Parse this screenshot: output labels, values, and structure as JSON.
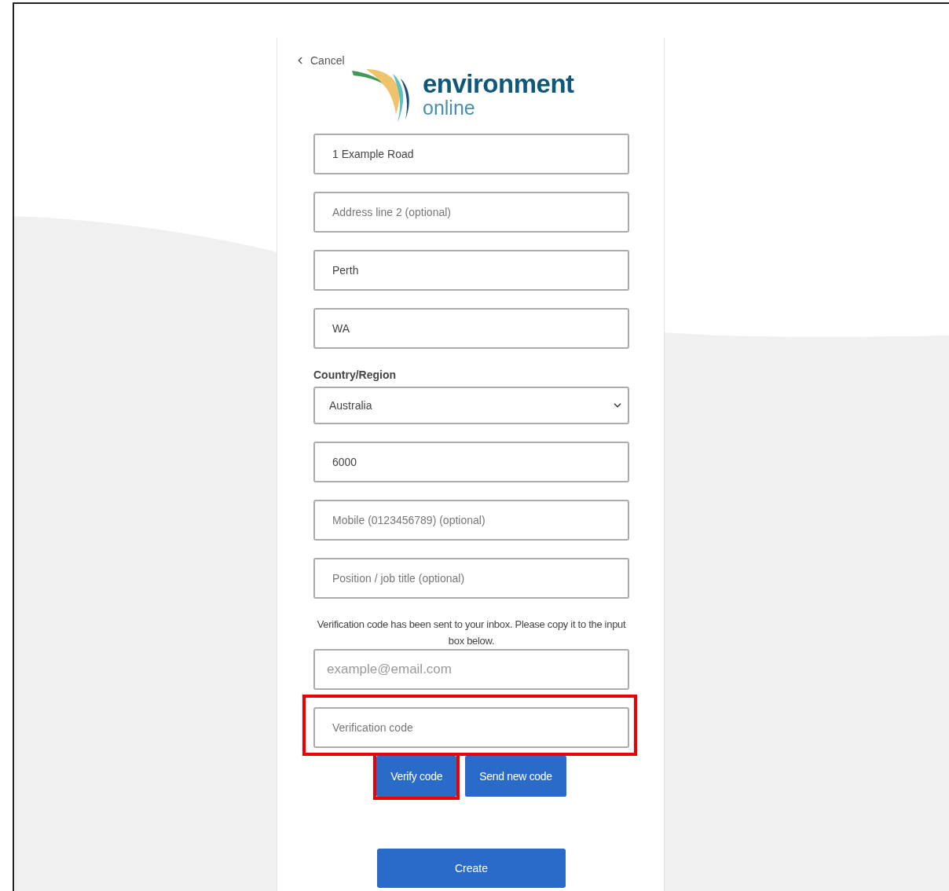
{
  "cancel_link": {
    "label": "Cancel"
  },
  "logo": {
    "title": "environment",
    "subtitle": "online"
  },
  "fields": [
    {
      "kind": "input",
      "value": "1 Example Road"
    },
    {
      "kind": "input",
      "placeholder": "Address line 2 (optional)"
    },
    {
      "kind": "input",
      "value": "Perth"
    },
    {
      "kind": "input",
      "value": "WA"
    },
    {
      "kind": "select",
      "label": "Country/Region",
      "value": "Australia"
    },
    {
      "kind": "input",
      "value": "6000"
    },
    {
      "kind": "input",
      "placeholder": "Mobile (0123456789) (optional)"
    },
    {
      "kind": "input",
      "placeholder": "Position / job title (optional)"
    }
  ],
  "verification_note": "Verification code has been sent to your inbox. Please copy it to the input box below.",
  "email_field": {
    "placeholder": "example@email.com"
  },
  "code_field": {
    "placeholder": "Verification code",
    "highlighted": true
  },
  "buttons": [
    {
      "label": "Verify code",
      "highlighted": true
    },
    {
      "label": "Send new code",
      "highlighted": false
    }
  ],
  "create_button": {
    "label": "Create"
  }
}
